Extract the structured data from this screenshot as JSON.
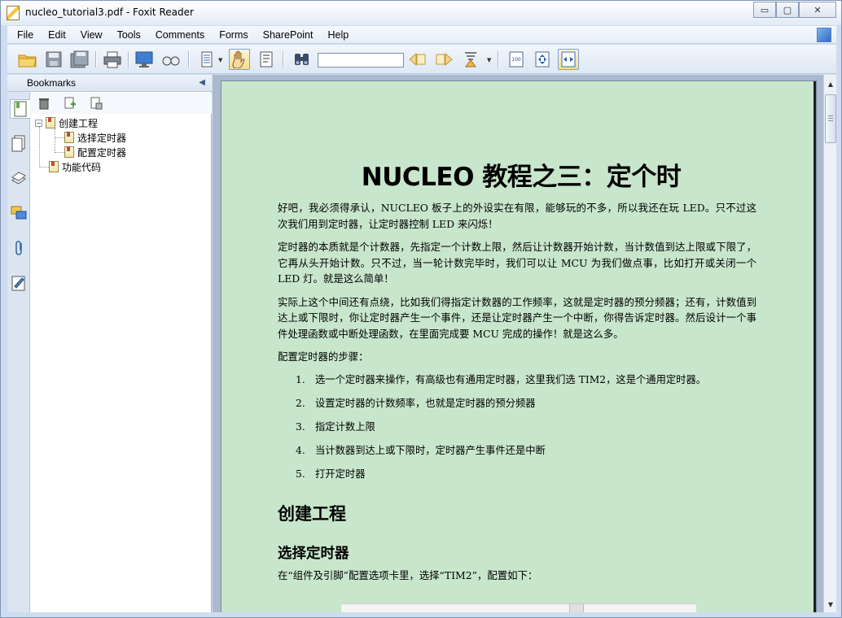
{
  "window": {
    "title": "nucleo_tutorial3.pdf - Foxit Reader",
    "minimize_glyph": "▭",
    "maximize_glyph": "▢",
    "close_glyph": "✕"
  },
  "menu": {
    "items": [
      "File",
      "Edit",
      "View",
      "Tools",
      "Comments",
      "Forms",
      "SharePoint",
      "Help"
    ]
  },
  "toolbar": {
    "search_value": "",
    "icons": [
      "open-folder-icon",
      "save-icon",
      "save-as-icon",
      "print-icon",
      "full-screen-icon",
      "loupe-icon",
      "page-view-icon",
      "hand-tool-icon",
      "select-text-icon",
      "find-icon",
      "previous-icon",
      "next-icon",
      "highlight-icon",
      "actual-size-icon",
      "fit-page-icon",
      "fit-width-icon"
    ]
  },
  "bookmarks": {
    "title": "Bookmarks",
    "tree": [
      {
        "label": "创建工程",
        "expanded": true,
        "toggle": "−"
      },
      {
        "label": "选择定时器"
      },
      {
        "label": "配置定时器"
      },
      {
        "label": "功能代码"
      }
    ]
  },
  "document": {
    "title": "NUCLEO 教程之三：定个时",
    "paragraphs": [
      "好吧，我必须得承认，NUCLEO 板子上的外设实在有限，能够玩的不多，所以我还在玩 LED。只不过这次我们用到定时器，让定时器控制 LED 来闪烁！",
      "定时器的本质就是个计数器，先指定一个计数上限，然后让计数器开始计数，当计数值到达上限或下限了，它再从头开始计数。只不过，当一轮计数完毕时，我们可以让 MCU 为我们做点事，比如打开或关闭一个 LED 灯。就是这么简单！",
      "实际上这个中间还有点绕，比如我们得指定计数器的工作频率，这就是定时器的预分频器；还有，计数值到达上或下限时，你让定时器产生一个事件，还是让定时器产生一个中断，你得告诉定时器。然后设计一个事件处理函数或中断处理函数，在里面完成要 MCU 完成的操作！就是这么多。",
      "配置定时器的步骤："
    ],
    "steps": [
      {
        "num": "1.",
        "text": "选一个定时器来操作，有高级也有通用定时器，这里我们选 TIM2，这是个通用定时器。"
      },
      {
        "num": "2.",
        "text": "设置定时器的计数频率，也就是定时器的预分频器"
      },
      {
        "num": "3.",
        "text": "指定计数上限"
      },
      {
        "num": "4.",
        "text": "当计数器到达上或下限时，定时器产生事件还是中断"
      },
      {
        "num": "5.",
        "text": "打开定时器"
      }
    ],
    "h2": "创建工程",
    "h3": "选择定时器",
    "last_paragraph": "在“组件及引脚”配置选项卡里，选择“TIM2”，配置如下："
  }
}
